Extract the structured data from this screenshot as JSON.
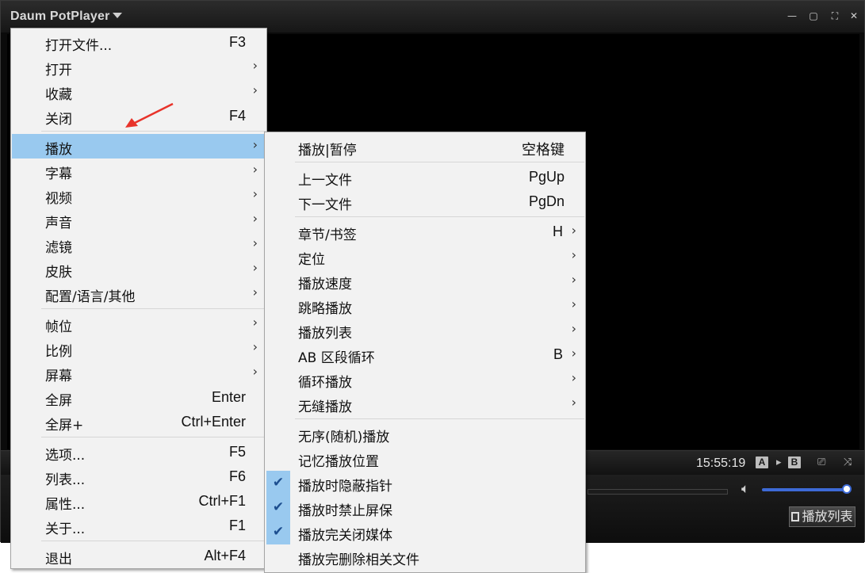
{
  "app": {
    "title": "Daum PotPlayer",
    "window_controls": [
      "—",
      "▢",
      "⛶",
      "✕"
    ]
  },
  "status": {
    "clock": "15:55:19",
    "box_a": "A",
    "box_b": "B"
  },
  "controls": {
    "playlist_label": "播放列表",
    "volume_level": 0.92
  },
  "main_menu": {
    "items": [
      {
        "label": "打开文件...",
        "shortcut": "F3",
        "submenu": false
      },
      {
        "label": "打开",
        "shortcut": "",
        "submenu": true
      },
      {
        "label": "收藏",
        "shortcut": "",
        "submenu": true
      },
      {
        "label": "关闭",
        "shortcut": "F4",
        "submenu": false
      },
      {
        "label": "播放",
        "shortcut": "",
        "submenu": true,
        "highlighted": true
      },
      {
        "label": "字幕",
        "shortcut": "",
        "submenu": true
      },
      {
        "label": "视频",
        "shortcut": "",
        "submenu": true
      },
      {
        "label": "声音",
        "shortcut": "",
        "submenu": true
      },
      {
        "label": "滤镜",
        "shortcut": "",
        "submenu": true
      },
      {
        "label": "皮肤",
        "shortcut": "",
        "submenu": true
      },
      {
        "label": "配置/语言/其他",
        "shortcut": "",
        "submenu": true
      },
      {
        "label": "帧位",
        "shortcut": "",
        "submenu": true
      },
      {
        "label": "比例",
        "shortcut": "",
        "submenu": true
      },
      {
        "label": "屏幕",
        "shortcut": "",
        "submenu": true
      },
      {
        "label": "全屏",
        "shortcut": "Enter",
        "submenu": false
      },
      {
        "label": "全屏+",
        "shortcut": "Ctrl+Enter",
        "submenu": false
      },
      {
        "label": "选项...",
        "shortcut": "F5",
        "submenu": false
      },
      {
        "label": "列表...",
        "shortcut": "F6",
        "submenu": false
      },
      {
        "label": "属性...",
        "shortcut": "Ctrl+F1",
        "submenu": false
      },
      {
        "label": "关于...",
        "shortcut": "F1",
        "submenu": false
      },
      {
        "label": "退出",
        "shortcut": "Alt+F4",
        "submenu": false
      }
    ]
  },
  "play_submenu": {
    "items": [
      {
        "label": "播放|暂停",
        "shortcut": "空格键",
        "submenu": false,
        "checked": false
      },
      {
        "label": "上一文件",
        "shortcut": "PgUp",
        "submenu": false,
        "checked": false
      },
      {
        "label": "下一文件",
        "shortcut": "PgDn",
        "submenu": false,
        "checked": false
      },
      {
        "label": "章节/书签",
        "shortcut": "H",
        "submenu": true,
        "checked": false
      },
      {
        "label": "定位",
        "shortcut": "",
        "submenu": true,
        "checked": false
      },
      {
        "label": "播放速度",
        "shortcut": "",
        "submenu": true,
        "checked": false
      },
      {
        "label": "跳略播放",
        "shortcut": "",
        "submenu": true,
        "checked": false
      },
      {
        "label": "播放列表",
        "shortcut": "",
        "submenu": true,
        "checked": false
      },
      {
        "label": "AB 区段循环",
        "shortcut": "B",
        "submenu": true,
        "checked": false
      },
      {
        "label": "循环播放",
        "shortcut": "",
        "submenu": true,
        "checked": false
      },
      {
        "label": "无缝播放",
        "shortcut": "",
        "submenu": true,
        "checked": false
      },
      {
        "label": "无序(随机)播放",
        "shortcut": "",
        "submenu": false,
        "checked": false
      },
      {
        "label": "记忆播放位置",
        "shortcut": "",
        "submenu": false,
        "checked": false
      },
      {
        "label": "播放时隐蔽指针",
        "shortcut": "",
        "submenu": false,
        "checked": true
      },
      {
        "label": "播放时禁止屏保",
        "shortcut": "",
        "submenu": false,
        "checked": true
      },
      {
        "label": "播放完关闭媒体",
        "shortcut": "",
        "submenu": false,
        "checked": true
      },
      {
        "label": "播放完删除相关文件",
        "shortcut": "",
        "submenu": false,
        "checked": false
      }
    ]
  },
  "colors": {
    "menu_bg": "#f2f2f2",
    "highlight": "#99c9ef",
    "annotation_arrow": "#e8332a",
    "volume": "#3d6ad6"
  }
}
